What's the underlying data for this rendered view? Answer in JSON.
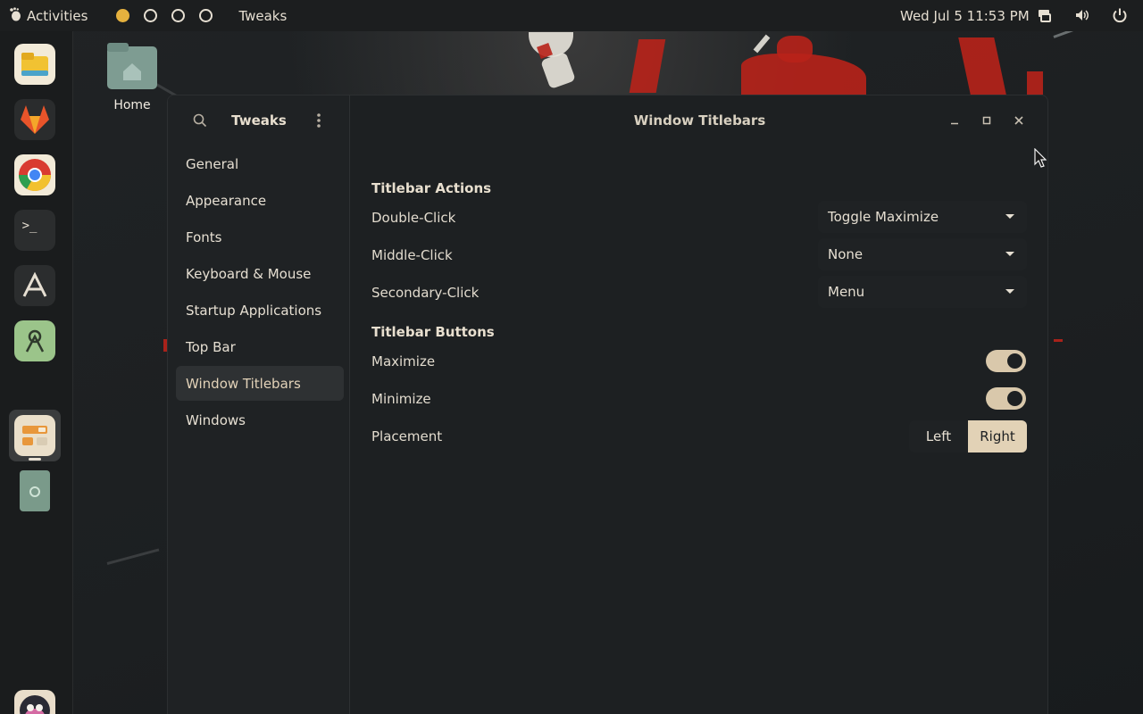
{
  "topbar": {
    "activities": "Activities",
    "app_name": "Tweaks",
    "clock": "Wed Jul 5  11:53 PM"
  },
  "desktop": {
    "home_label": "Home"
  },
  "window": {
    "title": "Window Titlebars",
    "sidebar_title": "Tweaks",
    "nav": [
      {
        "label": "General"
      },
      {
        "label": "Appearance"
      },
      {
        "label": "Fonts"
      },
      {
        "label": "Keyboard & Mouse"
      },
      {
        "label": "Startup Applications"
      },
      {
        "label": "Top Bar"
      },
      {
        "label": "Window Titlebars"
      },
      {
        "label": "Windows"
      }
    ],
    "selected_nav": "Window Titlebars",
    "actions_section": "Titlebar Actions",
    "actions": [
      {
        "label": "Double-Click",
        "value": "Toggle Maximize"
      },
      {
        "label": "Middle-Click",
        "value": "None"
      },
      {
        "label": "Secondary-Click",
        "value": "Menu"
      }
    ],
    "buttons_section": "Titlebar Buttons",
    "maximize": {
      "label": "Maximize",
      "on": true
    },
    "minimize": {
      "label": "Minimize",
      "on": true
    },
    "placement": {
      "label": "Placement",
      "left": "Left",
      "right": "Right",
      "selected": "Right"
    }
  },
  "colors": {
    "accent": "#e2d2b6",
    "workspace_active": "#e5b13e",
    "background": "#1d2022"
  }
}
